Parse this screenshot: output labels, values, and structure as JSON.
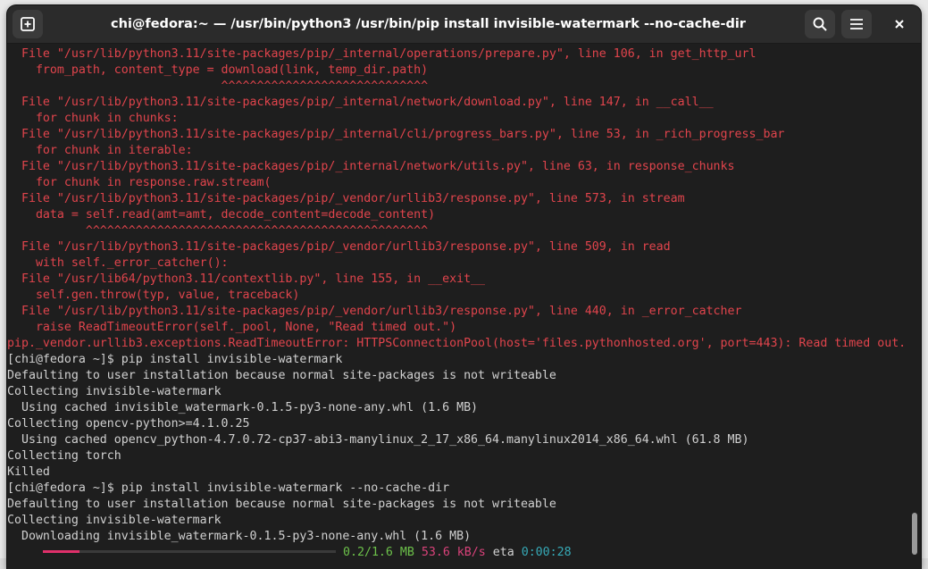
{
  "window": {
    "title": "chi@fedora:~ — /usr/bin/python3 /usr/bin/pip install invisible-watermark --no-cache-dir"
  },
  "icons": {
    "new_tab": "new-tab-icon",
    "search": "search-icon",
    "menu": "hamburger-menu-icon",
    "close": "close-icon"
  },
  "colors": {
    "background": "#1e1e1e",
    "error": "#e0444c",
    "text": "#d0d0d0",
    "progress": "#e0306a",
    "green": "#6cc04a",
    "cyan": "#36a9b6"
  },
  "terminal": {
    "lines": [
      {
        "text": "  File \"/usr/lib/python3.11/site-packages/pip/_internal/operations/prepare.py\", line 106, in get_http_url",
        "style": "err"
      },
      {
        "text": "    from_path, content_type = download(link, temp_dir.path)",
        "style": "err"
      },
      {
        "text": "                              ^^^^^^^^^^^^^^^^^^^^^^^^^^^^^",
        "style": "err"
      },
      {
        "text": "  File \"/usr/lib/python3.11/site-packages/pip/_internal/network/download.py\", line 147, in __call__",
        "style": "err"
      },
      {
        "text": "    for chunk in chunks:",
        "style": "err"
      },
      {
        "text": "  File \"/usr/lib/python3.11/site-packages/pip/_internal/cli/progress_bars.py\", line 53, in _rich_progress_bar",
        "style": "err"
      },
      {
        "text": "    for chunk in iterable:",
        "style": "err"
      },
      {
        "text": "  File \"/usr/lib/python3.11/site-packages/pip/_internal/network/utils.py\", line 63, in response_chunks",
        "style": "err"
      },
      {
        "text": "    for chunk in response.raw.stream(",
        "style": "err"
      },
      {
        "text": "  File \"/usr/lib/python3.11/site-packages/pip/_vendor/urllib3/response.py\", line 573, in stream",
        "style": "err"
      },
      {
        "text": "    data = self.read(amt=amt, decode_content=decode_content)",
        "style": "err"
      },
      {
        "text": "           ^^^^^^^^^^^^^^^^^^^^^^^^^^^^^^^^^^^^^^^^^^^^^^^^",
        "style": "err"
      },
      {
        "text": "  File \"/usr/lib/python3.11/site-packages/pip/_vendor/urllib3/response.py\", line 509, in read",
        "style": "err"
      },
      {
        "text": "    with self._error_catcher():",
        "style": "err"
      },
      {
        "text": "  File \"/usr/lib64/python3.11/contextlib.py\", line 155, in __exit__",
        "style": "err"
      },
      {
        "text": "    self.gen.throw(typ, value, traceback)",
        "style": "err"
      },
      {
        "text": "  File \"/usr/lib/python3.11/site-packages/pip/_vendor/urllib3/response.py\", line 440, in _error_catcher",
        "style": "err"
      },
      {
        "text": "    raise ReadTimeoutError(self._pool, None, \"Read timed out.\")",
        "style": "err"
      },
      {
        "text": "pip._vendor.urllib3.exceptions.ReadTimeoutError: HTTPSConnectionPool(host='files.pythonhosted.org', port=443): Read timed out.",
        "style": "err"
      },
      {
        "text": "[chi@fedora ~]$ pip install invisible-watermark",
        "style": "normal"
      },
      {
        "text": "Defaulting to user installation because normal site-packages is not writeable",
        "style": "normal"
      },
      {
        "text": "Collecting invisible-watermark",
        "style": "normal"
      },
      {
        "text": "  Using cached invisible_watermark-0.1.5-py3-none-any.whl (1.6 MB)",
        "style": "normal"
      },
      {
        "text": "Collecting opencv-python>=4.1.0.25",
        "style": "normal"
      },
      {
        "text": "  Using cached opencv_python-4.7.0.72-cp37-abi3-manylinux_2_17_x86_64.manylinux2014_x86_64.whl (61.8 MB)",
        "style": "normal"
      },
      {
        "text": "Collecting torch",
        "style": "normal"
      },
      {
        "text": "Killed",
        "style": "normal"
      },
      {
        "text": "[chi@fedora ~]$ pip install invisible-watermark --no-cache-dir",
        "style": "normal"
      },
      {
        "text": "Defaulting to user installation because normal site-packages is not writeable",
        "style": "normal"
      },
      {
        "text": "Collecting invisible-watermark",
        "style": "normal"
      },
      {
        "text": "  Downloading invisible_watermark-0.1.5-py3-none-any.whl (1.6 MB)",
        "style": "normal"
      }
    ],
    "progress": {
      "fraction": 0.125,
      "size": "0.2/1.6 MB",
      "speed": "53.6 kB/s",
      "eta_label": "eta",
      "eta": "0:00:28"
    }
  },
  "scrollbar": {
    "position": 0.97,
    "visible_fraction": 0.08
  }
}
